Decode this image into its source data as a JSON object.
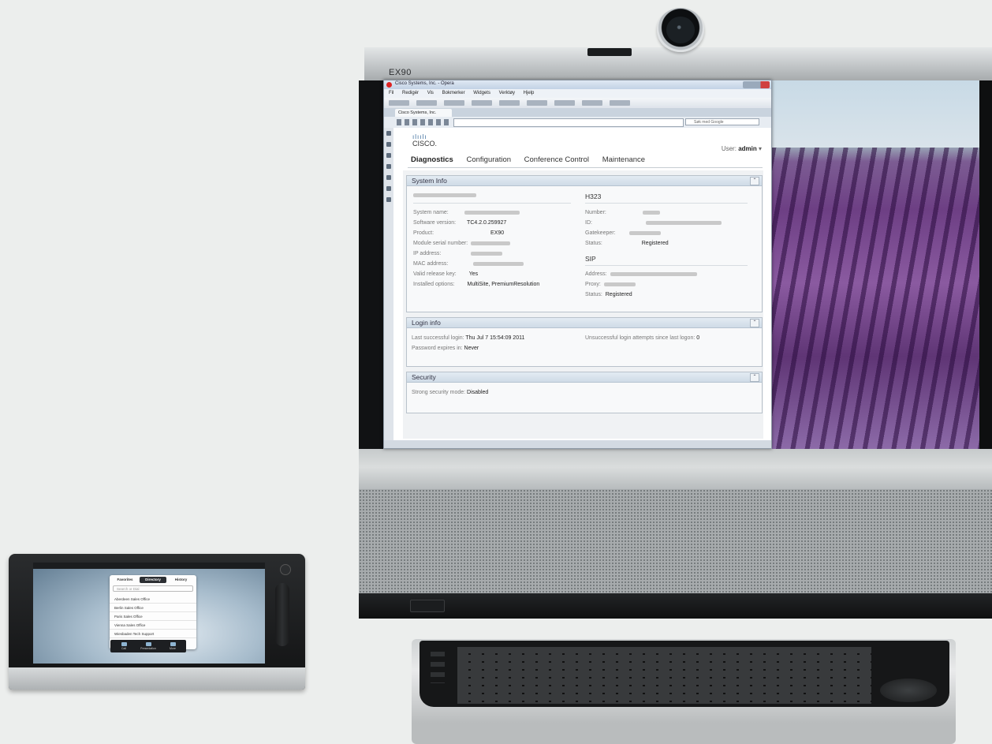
{
  "device": {
    "brand_label": "EX90"
  },
  "browser": {
    "window_title": "Cisco Systems, Inc. - Opera",
    "menu": [
      "Fil",
      "Redigér",
      "Vis",
      "Bokmerker",
      "Widgets",
      "Verktøy",
      "Hjelp"
    ],
    "tab_label": "Cisco Systems, Inc.",
    "search_placeholder": "Søk med Google"
  },
  "webpage": {
    "logo_bars": "ılıılı",
    "logo_text": "CISCO.",
    "user_prefix": "User:",
    "user_name": "admin",
    "nav": [
      "Diagnostics",
      "Configuration",
      "Conference Control",
      "Maintenance"
    ],
    "system_info": {
      "title": "System Info",
      "left_rows": [
        {
          "label": "System name:",
          "value": ""
        },
        {
          "label": "Software version:",
          "value": "TC4.2.0.259927"
        },
        {
          "label": "Product:",
          "value": "EX90"
        },
        {
          "label": "Module serial number:",
          "value": ""
        },
        {
          "label": "IP address:",
          "value": ""
        },
        {
          "label": "MAC address:",
          "value": ""
        },
        {
          "label": "Valid release key:",
          "value": "Yes"
        },
        {
          "label": "Installed options:",
          "value": "MultiSite, PremiumResolution"
        }
      ],
      "h323_title": "H323",
      "h323_rows": [
        {
          "label": "Number:",
          "value": ""
        },
        {
          "label": "ID:",
          "value": ""
        },
        {
          "label": "Gatekeeper:",
          "value": ""
        },
        {
          "label": "Status:",
          "value": "Registered"
        }
      ],
      "sip_title": "SIP",
      "sip_rows": [
        {
          "label": "Address:",
          "value": ""
        },
        {
          "label": "Proxy:",
          "value": ""
        },
        {
          "label": "Status:",
          "value": "Registered"
        }
      ]
    },
    "login_info": {
      "title": "Login info",
      "last_login_label": "Last successful login:",
      "last_login_value": "Thu Jul 7 15:54:09 2011",
      "expires_label": "Password expires in:",
      "expires_value": "Never",
      "failed_label": "Unsuccessful login attempts since last logon:",
      "failed_value": "0"
    },
    "security": {
      "title": "Security",
      "mode_label": "Strong security mode:",
      "mode_value": "Disabled"
    }
  },
  "touch_panel": {
    "tabs": [
      "Favorites",
      "Directory",
      "History"
    ],
    "search_placeholder": "Search or Dial",
    "entries": [
      "Aberdeen Sales Office",
      "Berlin Sales Office",
      "Paris Sales Office",
      "Vienna Sales Office",
      "Wiesbaden Tech Support"
    ],
    "dock": [
      "Call",
      "Presentation",
      "More"
    ]
  }
}
